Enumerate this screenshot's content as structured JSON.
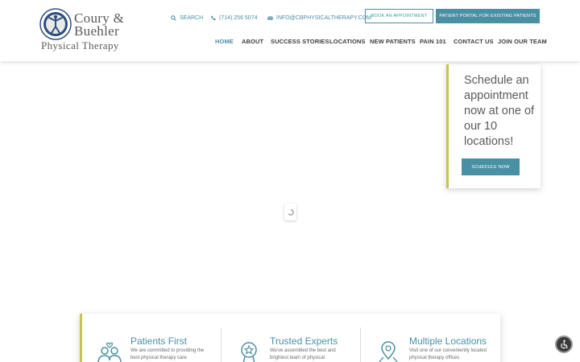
{
  "brand": {
    "logo_line1": "Coury &",
    "logo_line2": "Buehler",
    "logo_line3": "Physical Therapy"
  },
  "utility": {
    "search_label": "SEARCH",
    "phone": "(714) 256 5074",
    "email": "INFO@CBPHYSICALTHERAPY.COM",
    "book_label": "BOOK AN APPOINTMENT",
    "portal_label": "PATIENT PORTAL FOR EXISTING PATIENTS"
  },
  "nav": {
    "items": [
      {
        "label": "HOME",
        "active": true
      },
      {
        "label": "ABOUT"
      },
      {
        "label": "SUCCESS STORIES"
      },
      {
        "label": "LOCATIONS"
      },
      {
        "label": "NEW PATIENTS"
      },
      {
        "label": "PAIN 101"
      },
      {
        "label": "CONTACT US"
      },
      {
        "label": "JOIN OUR TEAM"
      }
    ]
  },
  "schedule": {
    "text": "Schedule an appointment now at one of our 10 locations!",
    "button_label": "SCHEDULE NOW"
  },
  "features": [
    {
      "title": "Patients First",
      "desc": "We are committed to providing the best physical therapy care",
      "icon": "people-icon"
    },
    {
      "title": "Trusted Experts",
      "desc": "We've assembled the best and brightest team of physical",
      "icon": "award-icon"
    },
    {
      "title": "Multiple Locations",
      "desc": "Visit one of our conveniently located physical therapy offices",
      "icon": "map-pin-icon"
    }
  ],
  "colors": {
    "accent": "#4a90a4",
    "highlight": "#c6c64a",
    "text": "#3d3d3d"
  }
}
